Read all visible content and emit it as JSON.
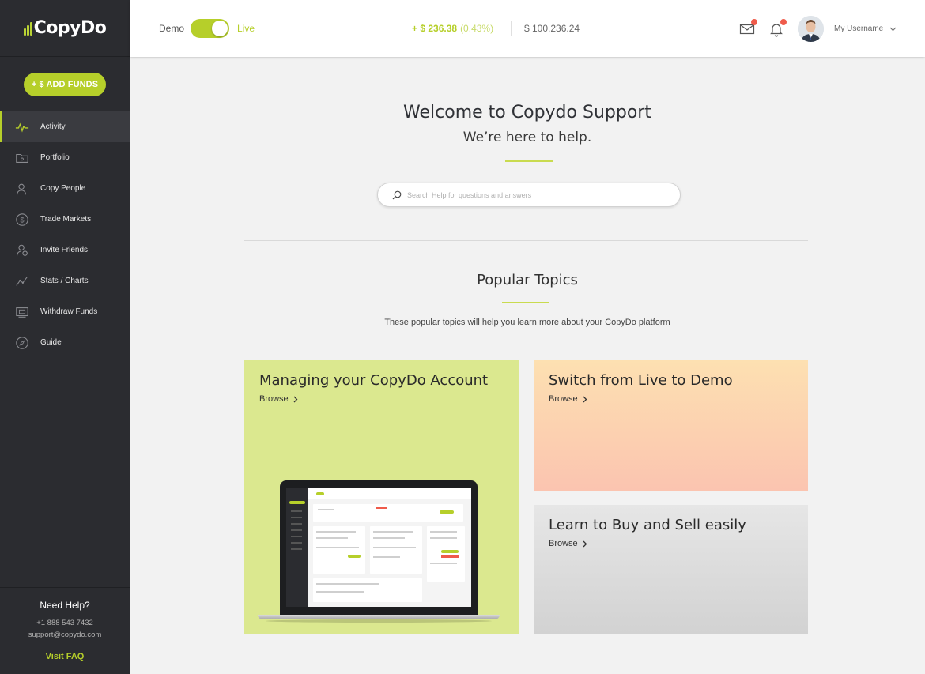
{
  "app": {
    "logo_text": "CopyDo",
    "add_funds_label": "+ $ ADD FUNDS",
    "accent_color": "#b6cf2a",
    "sidebar_color": "#2b2c30",
    "notification_color": "#ef5b4b"
  },
  "sidebar": {
    "items": [
      {
        "label": "Activity",
        "icon": "activity-pulse-icon",
        "active": true
      },
      {
        "label": "Portfolio",
        "icon": "portfolio-folder-icon",
        "active": false
      },
      {
        "label": "Copy People",
        "icon": "people-icon",
        "active": false
      },
      {
        "label": "Trade Markets",
        "icon": "dollar-coin-icon",
        "active": false
      },
      {
        "label": "Invite Friends",
        "icon": "invite-friend-icon",
        "active": false
      },
      {
        "label": "Stats / Charts",
        "icon": "stats-chart-icon",
        "active": false
      },
      {
        "label": "Withdraw Funds",
        "icon": "withdraw-icon",
        "active": false
      },
      {
        "label": "Guide",
        "icon": "compass-icon",
        "active": false
      }
    ],
    "help": {
      "title": "Need Help?",
      "phone": "+1 888 543 7432",
      "email": "support@copydo.com",
      "faq_label": "Visit FAQ"
    }
  },
  "topbar": {
    "mode_demo": "Demo",
    "mode_live": "Live",
    "mode_is_live": true,
    "pnl_value": "+ $ 236.38",
    "pnl_percent": "(0.43%)",
    "balance": "$ 100,236.24",
    "username": "My Username",
    "has_mail_notification": true,
    "has_bell_notification": true
  },
  "main": {
    "welcome_title": "Welcome to Copydo Support",
    "welcome_subtitle": "We’re here to help.",
    "search_placeholder": "Search Help for questions and answers",
    "popular_title": "Popular Topics",
    "popular_description": "These popular topics will help you learn more about your CopyDo platform",
    "topics": [
      {
        "title": "Managing your CopyDo Account",
        "browse_label": "Browse",
        "color": "#dbe88f"
      },
      {
        "title": "Switch from Live to Demo",
        "browse_label": "Browse",
        "color": "#fdd2b0"
      },
      {
        "title": "Learn to Buy and Sell easily",
        "browse_label": "Browse",
        "color": "#dcdcdc"
      }
    ]
  }
}
